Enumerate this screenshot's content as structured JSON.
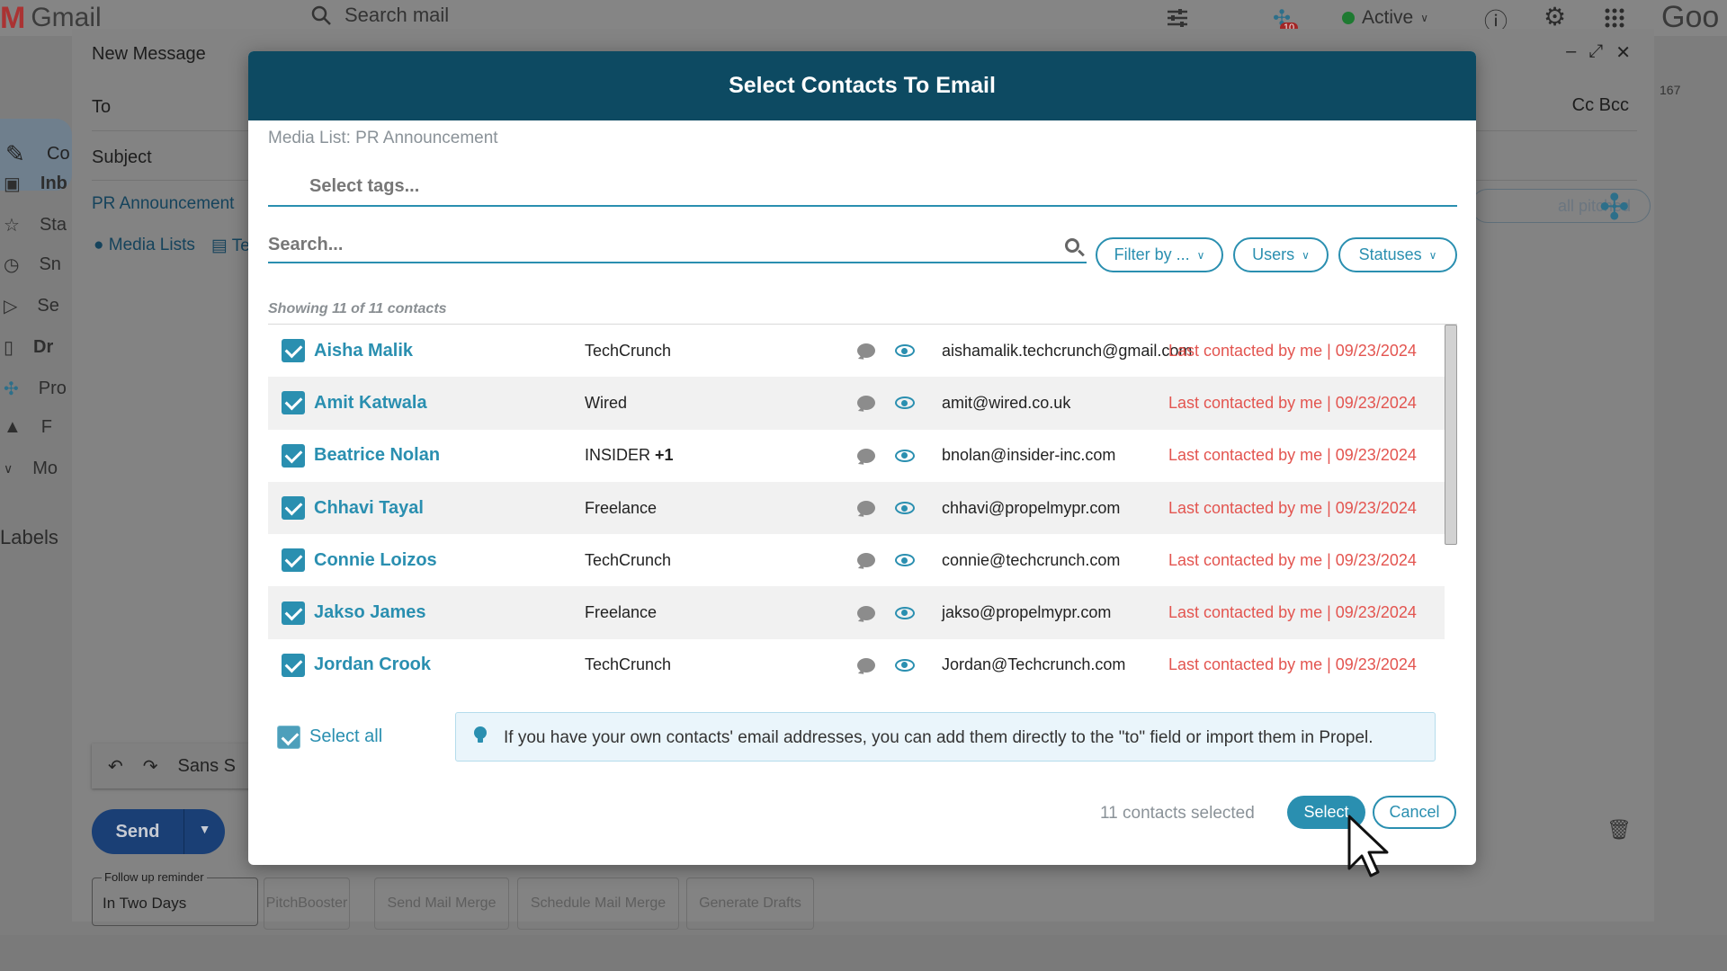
{
  "gmail": {
    "logo_word": "Gmail",
    "search_placeholder": "Search mail",
    "active_status": "Active",
    "notification_count": "10",
    "brand_suffix": "Goo",
    "page_number": "167",
    "sidebar": {
      "compose": "Co",
      "items": [
        "Inb",
        "Sta",
        "Sn",
        "Se",
        "Dr",
        "Pro",
        "F",
        "Mo"
      ]
    },
    "labels_heading": "Labels"
  },
  "compose": {
    "title": "New Message",
    "to_label": "To",
    "subject_label": "Subject",
    "cc_bcc": "Cc Bcc",
    "pr_tag": "PR Announcement",
    "media_lists_link": "Media Lists",
    "templates_link": "Te",
    "all_pitched": "all pitched",
    "font_label": "Sans S",
    "send_label": "Send",
    "follow_up_legend": "Follow up reminder",
    "follow_up_value": "In Two Days",
    "buttons": [
      "PitchBooster",
      "Send Mail Merge",
      "Schedule Mail Merge",
      "Generate Drafts"
    ]
  },
  "modal": {
    "title": "Select Contacts To Email",
    "media_list_label": "Media List: PR Announcement",
    "tags_placeholder": "Select tags...",
    "search_placeholder": "Search...",
    "filters": [
      "Filter by ...",
      "Users",
      "Statuses"
    ],
    "showing_text": "Showing 11 of 11 contacts",
    "contacts": [
      {
        "name": "Aisha Malik",
        "outlet": "TechCrunch",
        "outlet_extra": "",
        "email": "aishamalik.techcrunch@gmail.com",
        "last_contacted": "Last contacted by me | 09/23/2024"
      },
      {
        "name": "Amit Katwala",
        "outlet": "Wired",
        "outlet_extra": "",
        "email": "amit@wired.co.uk",
        "last_contacted": "Last contacted by me | 09/23/2024"
      },
      {
        "name": "Beatrice Nolan",
        "outlet": "INSIDER",
        "outlet_extra": "+1",
        "email": "bnolan@insider-inc.com",
        "last_contacted": "Last contacted by me | 09/23/2024"
      },
      {
        "name": "Chhavi Tayal",
        "outlet": "Freelance",
        "outlet_extra": "",
        "email": "chhavi@propelmypr.com",
        "last_contacted": "Last contacted by me | 09/23/2024"
      },
      {
        "name": "Connie Loizos",
        "outlet": "TechCrunch",
        "outlet_extra": "",
        "email": "connie@techcrunch.com",
        "last_contacted": "Last contacted by me | 09/23/2024"
      },
      {
        "name": "Jakso James",
        "outlet": "Freelance",
        "outlet_extra": "",
        "email": "jakso@propelmypr.com",
        "last_contacted": "Last contacted by me | 09/23/2024"
      },
      {
        "name": "Jordan Crook",
        "outlet": "TechCrunch",
        "outlet_extra": "",
        "email": "Jordan@Techcrunch.com",
        "last_contacted": "Last contacted by me | 09/23/2024"
      }
    ],
    "select_all_label": "Select all",
    "info_text": "If you have your own contacts' email addresses, you can add them directly to the \"to\" field or import them in Propel.",
    "selected_count": "11 contacts selected",
    "select_button": "Select",
    "cancel_button": "Cancel"
  },
  "colors": {
    "modal_header": "#0d4a62",
    "accent": "#2a8fb0",
    "last_contacted": "#e35550",
    "send_button": "#1a3f75"
  }
}
